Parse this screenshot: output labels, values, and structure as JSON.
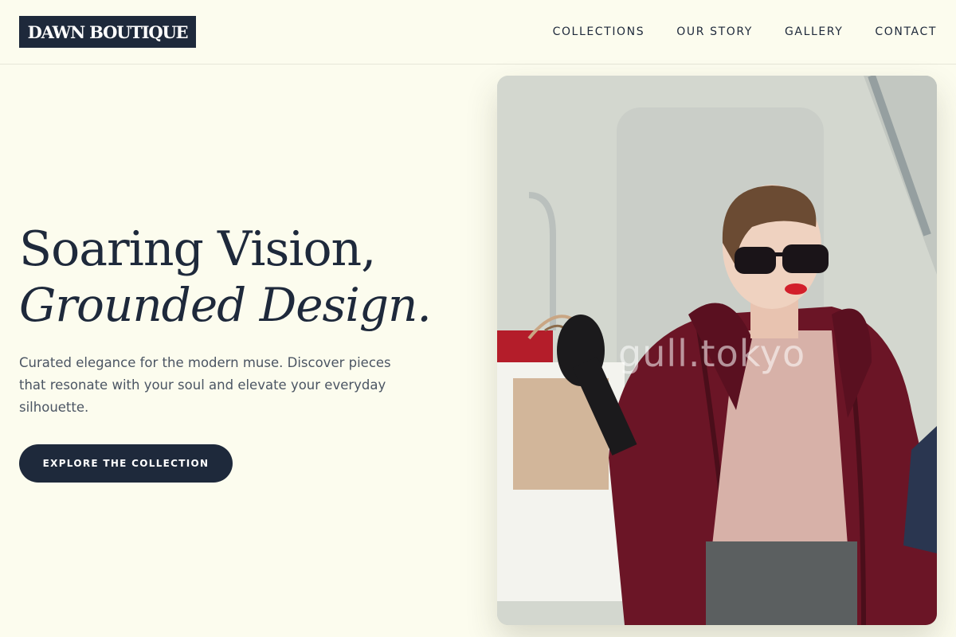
{
  "brand": {
    "logo_text": "DAWN BOUTIQUE"
  },
  "nav": {
    "items": [
      {
        "label": "COLLECTIONS"
      },
      {
        "label": "OUR STORY"
      },
      {
        "label": "GALLERY"
      },
      {
        "label": "CONTACT"
      }
    ]
  },
  "hero": {
    "headline_line1": "Soaring Vision,",
    "headline_line2": "Grounded Design.",
    "subtext": "Curated elegance for the modern muse. Discover pieces that resonate with your soul and elevate your everyday silhouette.",
    "cta_label": "EXPLORE THE COLLECTION",
    "image_watermark": "gull.tokyo"
  },
  "colors": {
    "background": "#fcfcee",
    "primary": "#1e293b",
    "body_text": "#4b5563",
    "coat": "#6b1526"
  }
}
